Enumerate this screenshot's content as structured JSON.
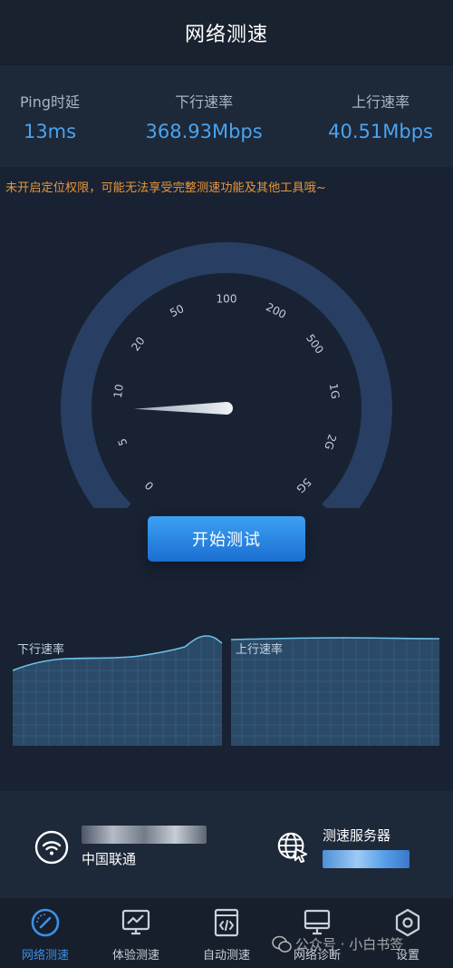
{
  "header": {
    "title": "网络测速"
  },
  "stats": [
    {
      "label": "Ping时延",
      "value": "13ms"
    },
    {
      "label": "下行速率",
      "value": "368.93Mbps"
    },
    {
      "label": "上行速率",
      "value": "40.51Mbps"
    }
  ],
  "warning": "未开启定位权限，可能无法享受完整测速功能及其他工具哦~",
  "gauge": {
    "ticks": [
      "0",
      "5",
      "10",
      "20",
      "50",
      "100",
      "200",
      "500",
      "1G",
      "2G",
      "5G"
    ],
    "needle_scale_position": 0.165
  },
  "start_button": "开始测试",
  "charts": {
    "download_label": "下行速率",
    "upload_label": "上行速率"
  },
  "info": {
    "isp_name": "中国联通",
    "server_title": "测速服务器"
  },
  "nav": [
    {
      "label": "网络测速",
      "icon": "speedometer-icon",
      "active": true
    },
    {
      "label": "体验测速",
      "icon": "monitor-chart-icon",
      "active": false
    },
    {
      "label": "自动测速",
      "icon": "code-document-icon",
      "active": false
    },
    {
      "label": "网络诊断",
      "icon": "computer-icon",
      "active": false
    },
    {
      "label": "设置",
      "icon": "settings-icon",
      "active": false
    }
  ],
  "watermark": "公众号 · 小白书签",
  "colors": {
    "accent": "#3d8fe6",
    "value_blue": "#4aa3ee",
    "warning": "#e8953a",
    "gauge_ring": "#283e63"
  }
}
